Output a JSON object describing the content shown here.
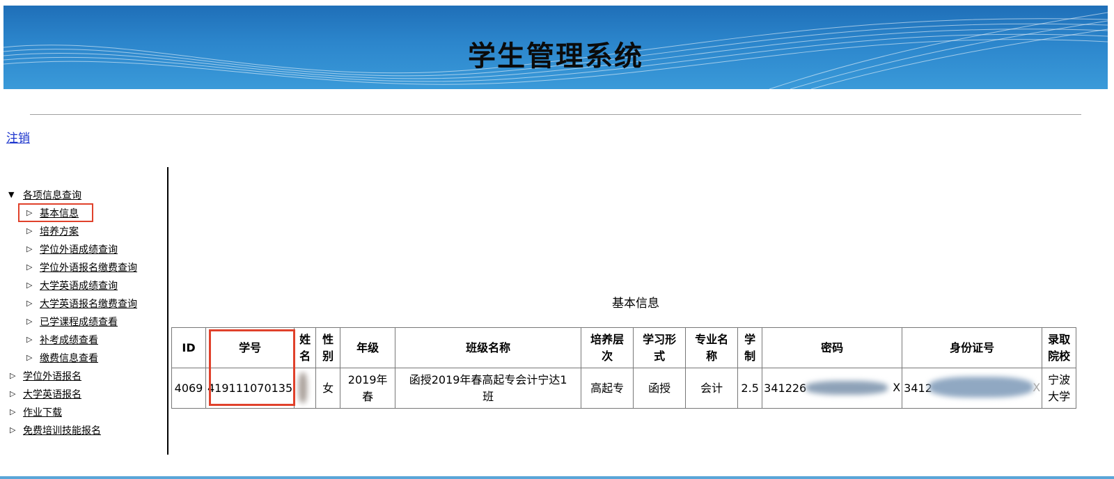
{
  "header": {
    "title": "学生管理系统"
  },
  "logout_label": "注销",
  "nav": {
    "group1": {
      "label": "各项信息查询",
      "items": [
        "基本信息",
        "培养方案",
        "学位外语成绩查询",
        "学位外语报名缴费查询",
        "大学英语成绩查询",
        "大学英语报名缴费查询",
        "已学课程成绩查看",
        "补考成绩查看",
        "缴费信息查看"
      ]
    },
    "others": [
      "学位外语报名",
      "大学英语报名",
      "作业下载",
      "免费培训技能报名"
    ]
  },
  "main": {
    "title": "基本信息",
    "table": {
      "headers": [
        "ID",
        "学号",
        "姓\n名",
        "性\n别",
        "年级",
        "班级名称",
        "培养层\n次",
        "学习形\n式",
        "专业名\n称",
        "学\n制",
        "密码",
        "身份证号",
        "录取\n院校"
      ],
      "row": [
        "4069",
        "419111070135",
        "",
        "女",
        "2019年\n春",
        "函授2019年春高起专会计宁达1\n班",
        "高起专",
        "函授",
        "会计",
        "2.5",
        "341226",
        "3412",
        "宁波\n大学"
      ],
      "password_suffix": "X",
      "idcard_suffix": "X"
    }
  },
  "colors": {
    "highlight": "#e0412b",
    "banner": "#2c86cc",
    "link": "#1a33cc"
  }
}
